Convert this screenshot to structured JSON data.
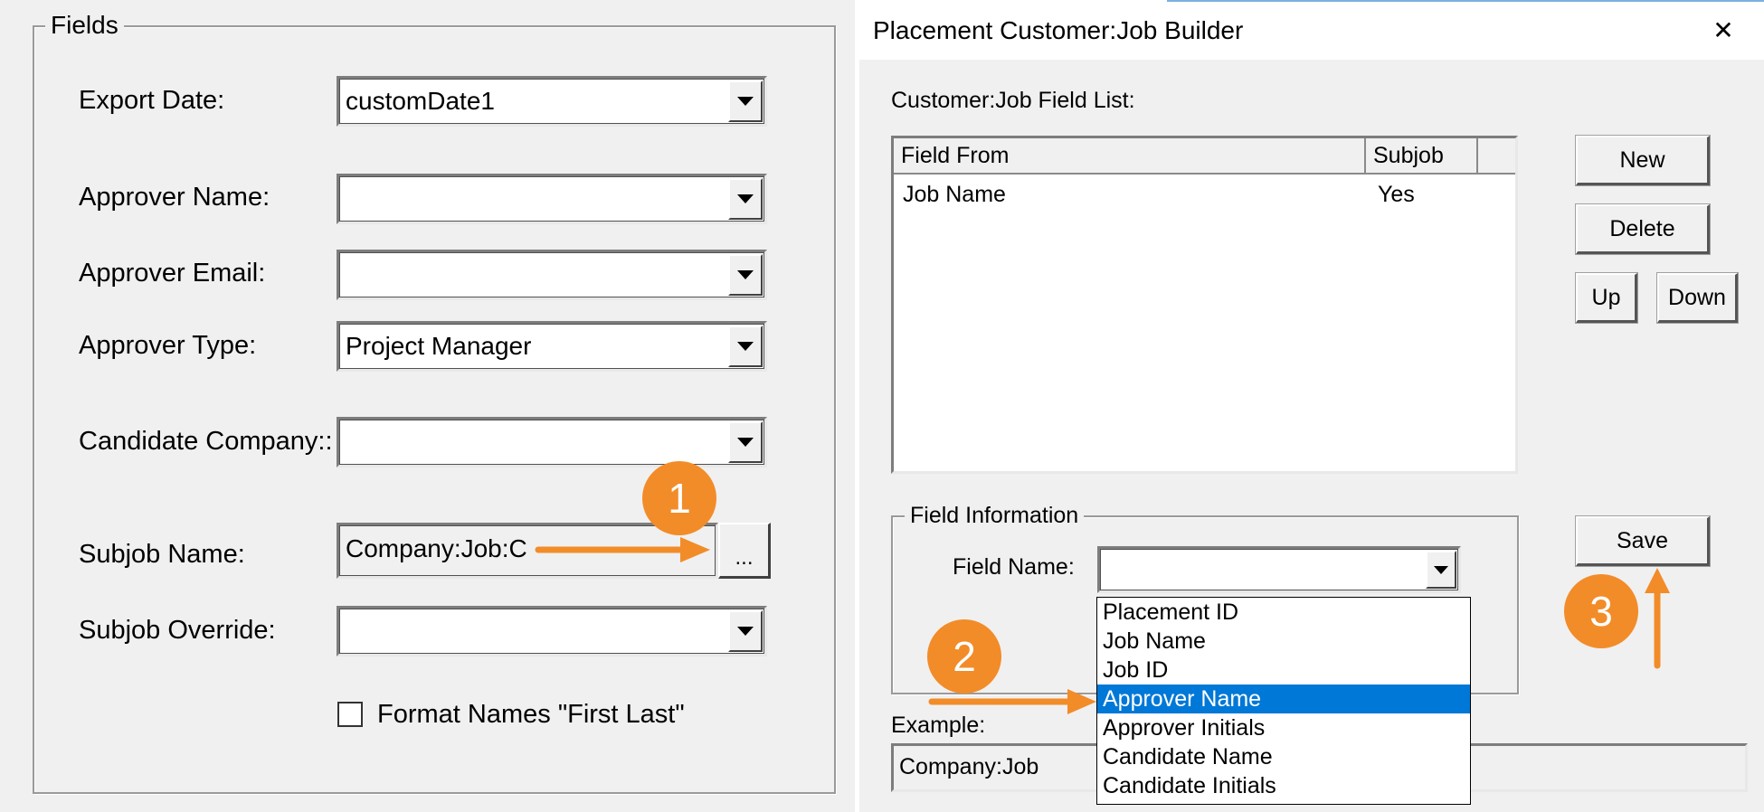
{
  "colors": {
    "annotation": "#f28c28",
    "selection": "#0078d7"
  },
  "left": {
    "group_title": "Fields",
    "rows": {
      "export_date": {
        "label": "Export Date:",
        "value": "customDate1"
      },
      "approver_name": {
        "label": "Approver Name:",
        "value": ""
      },
      "approver_email": {
        "label": "Approver Email:",
        "value": ""
      },
      "approver_type": {
        "label": "Approver Type:",
        "value": "Project Manager"
      },
      "candidate_company": {
        "label": "Candidate Company::",
        "value": ""
      },
      "subjob_name": {
        "label": "Subjob Name:",
        "value": "Company:Job:C",
        "button": "..."
      },
      "subjob_override": {
        "label": "Subjob Override:",
        "value": ""
      }
    },
    "format_names": {
      "label": "Format Names \"First Last\"",
      "checked": false
    }
  },
  "dialog": {
    "title": "Placement Customer:Job Builder",
    "close_glyph": "✕",
    "field_list_label": "Customer:Job Field List:",
    "columns": [
      "Field From",
      "Subjob"
    ],
    "rows": [
      {
        "field_from": "Job Name",
        "subjob": "Yes"
      }
    ],
    "buttons": {
      "new": "New",
      "delete": "Delete",
      "up": "Up",
      "down": "Down",
      "save": "Save"
    },
    "field_info": {
      "group_title": "Field Information",
      "field_name_label": "Field Name:",
      "field_name_value": "",
      "options": [
        "Placement ID",
        "Job Name",
        "Job ID",
        "Approver Name",
        "Approver Initials",
        "Candidate Name",
        "Candidate Initials"
      ],
      "selected_option": "Approver Name"
    },
    "example": {
      "label": "Example:",
      "value": "Company:Job"
    }
  },
  "annotations": {
    "step1": "1",
    "step2": "2",
    "step3": "3"
  }
}
